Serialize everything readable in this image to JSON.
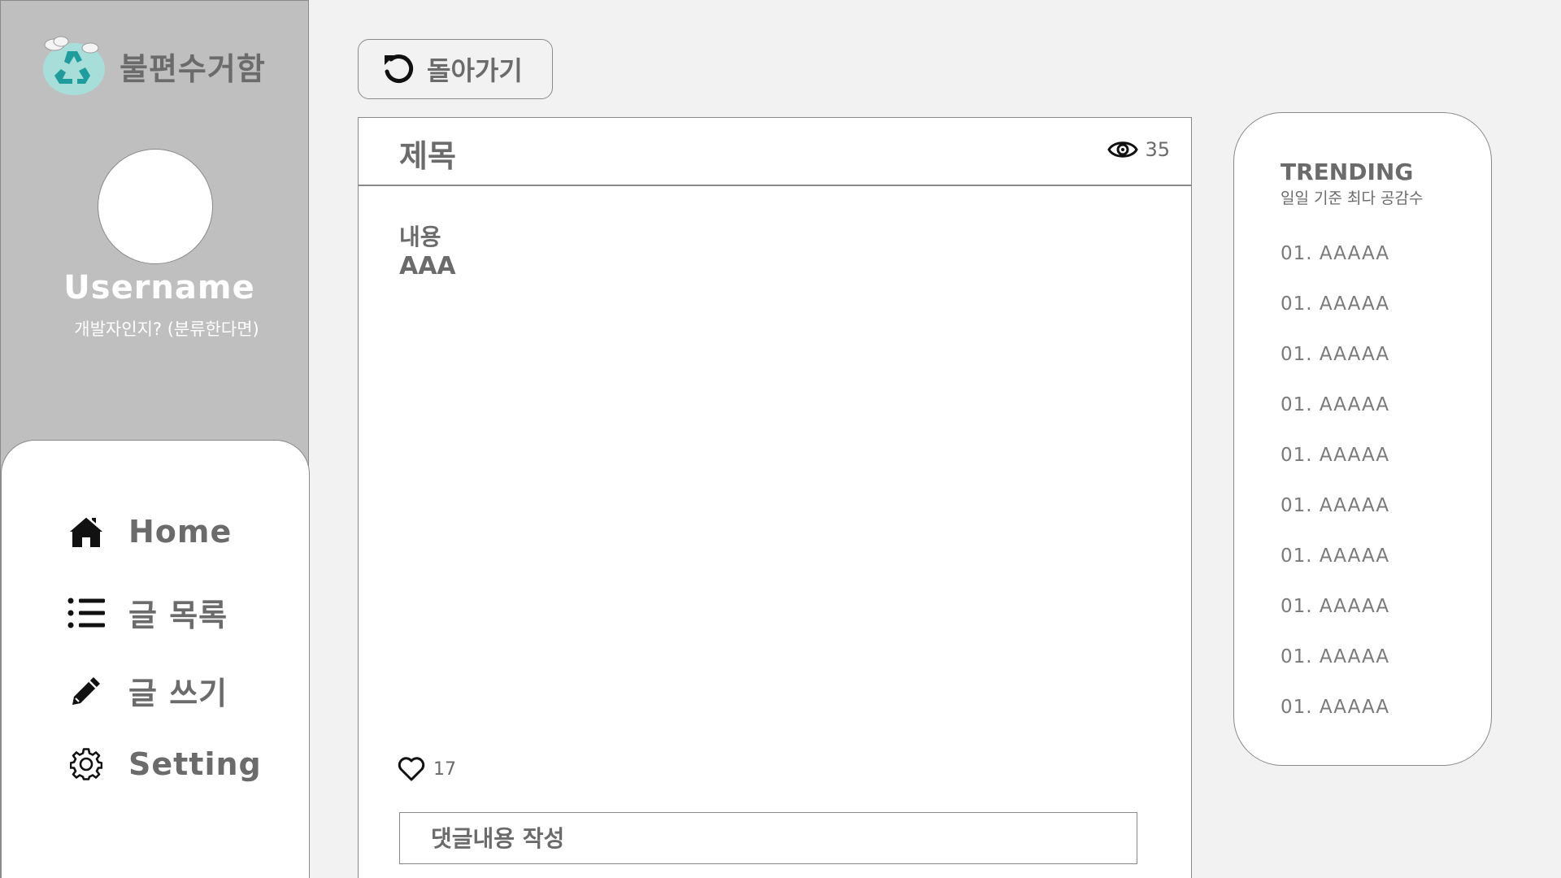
{
  "app": {
    "name": "불편수거함",
    "logo_icon": "recycle-cloud-icon"
  },
  "profile": {
    "username": "Username",
    "usertype": "개발자인지? (분류한다면)"
  },
  "nav": {
    "items": [
      {
        "label": "Home",
        "icon": "home-icon"
      },
      {
        "label": "글 목록",
        "icon": "list-icon"
      },
      {
        "label": "글 쓰기",
        "icon": "pencil-icon"
      },
      {
        "label": "Setting",
        "icon": "gear-icon"
      }
    ]
  },
  "back_button": {
    "label": "돌아가기",
    "icon": "undo-icon"
  },
  "post": {
    "title": "제목",
    "views": "35",
    "body_label": "내용",
    "body_text": "AAA",
    "likes": "17",
    "comment_placeholder": "댓글내용 작성"
  },
  "trending": {
    "title": "TRENDING",
    "subtitle": "일일 기준 최다 공감수",
    "items": [
      "01. AAAAA",
      "01. AAAAA",
      "01. AAAAA",
      "01. AAAAA",
      "01. AAAAA",
      "01. AAAAA",
      "01. AAAAA",
      "01. AAAAA",
      "01. AAAAA",
      "01. AAAAA"
    ]
  },
  "colors": {
    "sidebar_bg": "#bfbfbf",
    "page_bg": "#f2f2f2",
    "text": "#6b6b6b",
    "border": "#8a8a8a",
    "logo_teal": "#1f9c9c",
    "logo_cloud": "#a8ded9"
  }
}
